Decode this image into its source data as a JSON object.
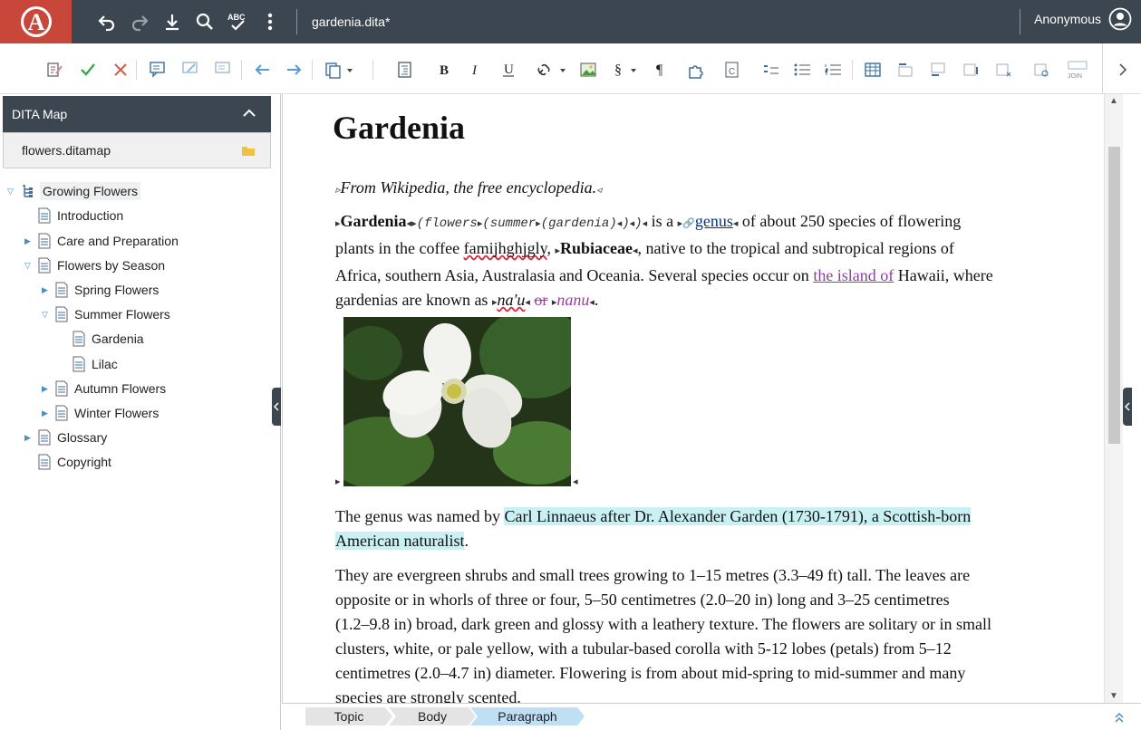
{
  "app": {
    "filename": "gardenia.dita*",
    "user": "Anonymous"
  },
  "topbar": {
    "icons": [
      "undo-icon",
      "redo-icon",
      "download-icon",
      "search-icon",
      "spellcheck-icon",
      "more-icon"
    ],
    "spellcheck_text": "ABC"
  },
  "sidebar": {
    "header": "DITA Map",
    "map_file": "flowers.ditamap",
    "items": [
      {
        "label": "Growing Flowers"
      },
      {
        "label": "Introduction"
      },
      {
        "label": "Care and Preparation"
      },
      {
        "label": "Flowers by Season"
      },
      {
        "label": "Spring Flowers"
      },
      {
        "label": "Summer Flowers"
      },
      {
        "label": "Gardenia"
      },
      {
        "label": "Lilac"
      },
      {
        "label": "Autumn Flowers"
      },
      {
        "label": "Winter Flowers"
      },
      {
        "label": "Glossary"
      },
      {
        "label": "Copyright"
      }
    ]
  },
  "toolbar": {
    "join_label": "JOIN"
  },
  "document": {
    "title": "Gardenia",
    "shortdesc": "From Wikipedia, the free encyclopedia.",
    "p1": {
      "term": "Gardenia",
      "mono1": "(flowers",
      "mono2": "(summer",
      "mono3": "(gardenia)",
      "mono4": ")",
      "mono5": ")",
      "is_a": "is a",
      "genus_link": "genus",
      "text1": "of about 250 species of flowering",
      "text2a": "plants in the coffee",
      "misspelled": "famijhghjgly",
      "family": "Rubiaceae",
      "text2b": ", native to the tropical and subtropical regions of",
      "text3a": "Africa, southern Asia, Australasia and Oceania. Several species occur on",
      "island_link": "the island of",
      "text3b": "Hawaii, where",
      "text4a": "gardenias are known as",
      "naau": "na'u",
      "or": "or",
      "nanu": "nanu",
      "period": "."
    },
    "p2": {
      "text_a": "The genus was named by",
      "highlight1": "Carl Linnaeus after Dr. Alexander Garden (1730-1791), a Scottish-born",
      "highlight2": "American naturalist",
      "text_b": "."
    },
    "p3": {
      "line1": "They are evergreen shrubs and small trees growing to 1–15 metres (3.3–49 ft) tall. The leaves are",
      "line2": "opposite or in whorls of three or four, 5–50 centimetres (2.0–20 in) long and 3–25 centimetres",
      "line3": "(1.2–9.8 in) broad, dark green and glossy with a leathery texture. The flowers are solitary or in small",
      "line4": "clusters, white, or pale yellow, with a tubular-based corolla with 5-12 lobes (petals) from 5–12",
      "line5": "centimetres (2.0–4.7 in) diameter. Flowering is from about mid-spring to mid-summer and many",
      "line6": "species are strongly scented."
    }
  },
  "breadcrumb": [
    "Topic",
    "Body",
    "Paragraph"
  ],
  "colors": {
    "topbar": "#3c4650",
    "logo": "#c8463a",
    "highlight": "#c9f1f3",
    "link_visited": "#8a3fa0"
  }
}
